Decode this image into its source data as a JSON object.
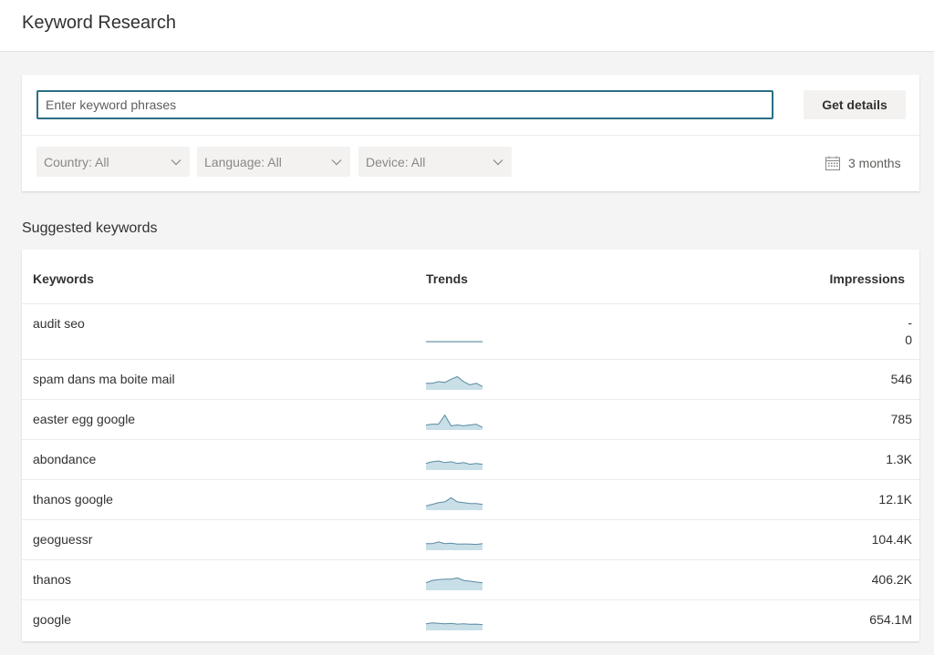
{
  "page": {
    "title": "Keyword Research"
  },
  "search": {
    "placeholder": "Enter keyword phrases",
    "value": "",
    "button_label": "Get details"
  },
  "filters": {
    "country": "Country: All",
    "language": "Language: All",
    "device": "Device: All",
    "period": "3 months"
  },
  "suggested": {
    "title": "Suggested keywords",
    "columns": {
      "keywords": "Keywords",
      "trends": "Trends",
      "impressions": "Impressions"
    },
    "rows": [
      {
        "keyword": "audit seo",
        "impressions_top": "-",
        "impressions": "0",
        "trend": [
          0,
          0,
          0,
          0,
          0,
          0,
          0,
          0,
          0,
          0
        ]
      },
      {
        "keyword": "spam dans ma boite mail",
        "impressions": "546",
        "trend": [
          0.35,
          0.35,
          0.45,
          0.4,
          0.6,
          0.75,
          0.45,
          0.25,
          0.35,
          0.15
        ]
      },
      {
        "keyword": "easter egg google",
        "impressions": "785",
        "trend": [
          0.25,
          0.3,
          0.3,
          0.85,
          0.2,
          0.25,
          0.2,
          0.25,
          0.3,
          0.1
        ]
      },
      {
        "keyword": "abondance",
        "impressions": "1.3K",
        "trend": [
          0.35,
          0.45,
          0.5,
          0.4,
          0.45,
          0.35,
          0.4,
          0.3,
          0.35,
          0.3
        ]
      },
      {
        "keyword": "thanos google",
        "impressions": "12.1K",
        "trend": [
          0.2,
          0.3,
          0.4,
          0.45,
          0.7,
          0.45,
          0.4,
          0.35,
          0.35,
          0.3
        ]
      },
      {
        "keyword": "geoguessr",
        "impressions": "104.4K",
        "trend": [
          0.35,
          0.35,
          0.45,
          0.35,
          0.38,
          0.32,
          0.33,
          0.32,
          0.3,
          0.35
        ]
      },
      {
        "keyword": "thanos",
        "impressions": "406.2K",
        "trend": [
          0.4,
          0.55,
          0.6,
          0.62,
          0.62,
          0.7,
          0.55,
          0.5,
          0.45,
          0.4
        ]
      },
      {
        "keyword": "google",
        "impressions": "654.1M",
        "trend": [
          0.35,
          0.4,
          0.38,
          0.35,
          0.38,
          0.33,
          0.35,
          0.32,
          0.33,
          0.3
        ]
      }
    ]
  },
  "colors": {
    "input_border": "#2b6f86",
    "spark_line": "#5b8aa0",
    "spark_fill": "#c9dfe8",
    "header_bg": "#ffffff",
    "page_bg": "#f4f4f4"
  },
  "icons": {
    "dropdown": "chevron-down-icon",
    "period": "calendar-icon"
  }
}
